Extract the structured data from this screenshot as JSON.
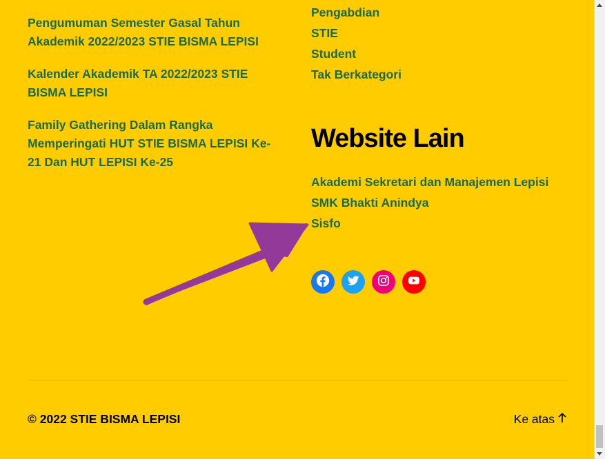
{
  "recent_posts": [
    "Pengumuman Semester Gasal Tahun Akademik 2022/2023 STIE BISMA LEPISI",
    "Kalender Akademik TA 2022/2023 STIE BISMA LEPISI",
    "Family Gathering Dalam Rangka Memperingati HUT STIE BISMA LEPISI Ke-21 Dan HUT LEPISI Ke-25"
  ],
  "categories": [
    "Pengabdian",
    "STIE",
    "Student",
    "Tak Berkategori"
  ],
  "website_lain": {
    "title": "Website Lain",
    "links": [
      "Akademi Sekretari dan Manajemen Lepisi",
      "SMK Bhakti Anindya",
      "Sisfo"
    ]
  },
  "social": [
    {
      "name": "Facebook",
      "icon": "facebook-icon",
      "color": "#1877f2"
    },
    {
      "name": "Twitter",
      "icon": "twitter-icon",
      "color": "#1da1f2"
    },
    {
      "name": "Instagram",
      "icon": "instagram-icon",
      "color": "#f00075"
    },
    {
      "name": "YouTube",
      "icon": "youtube-icon",
      "color": "#ff0000"
    }
  ],
  "footer": {
    "copyright": "© 2022 STIE BISMA LEPISI",
    "to_top": "Ke atas",
    "to_top_icon": "arrow-up-icon"
  },
  "colors": {
    "background": "#ffcc00",
    "link": "#1a6a49",
    "annotation_arrow": "#93399a"
  },
  "annotation": {
    "icon": "annotation-arrow-icon"
  }
}
